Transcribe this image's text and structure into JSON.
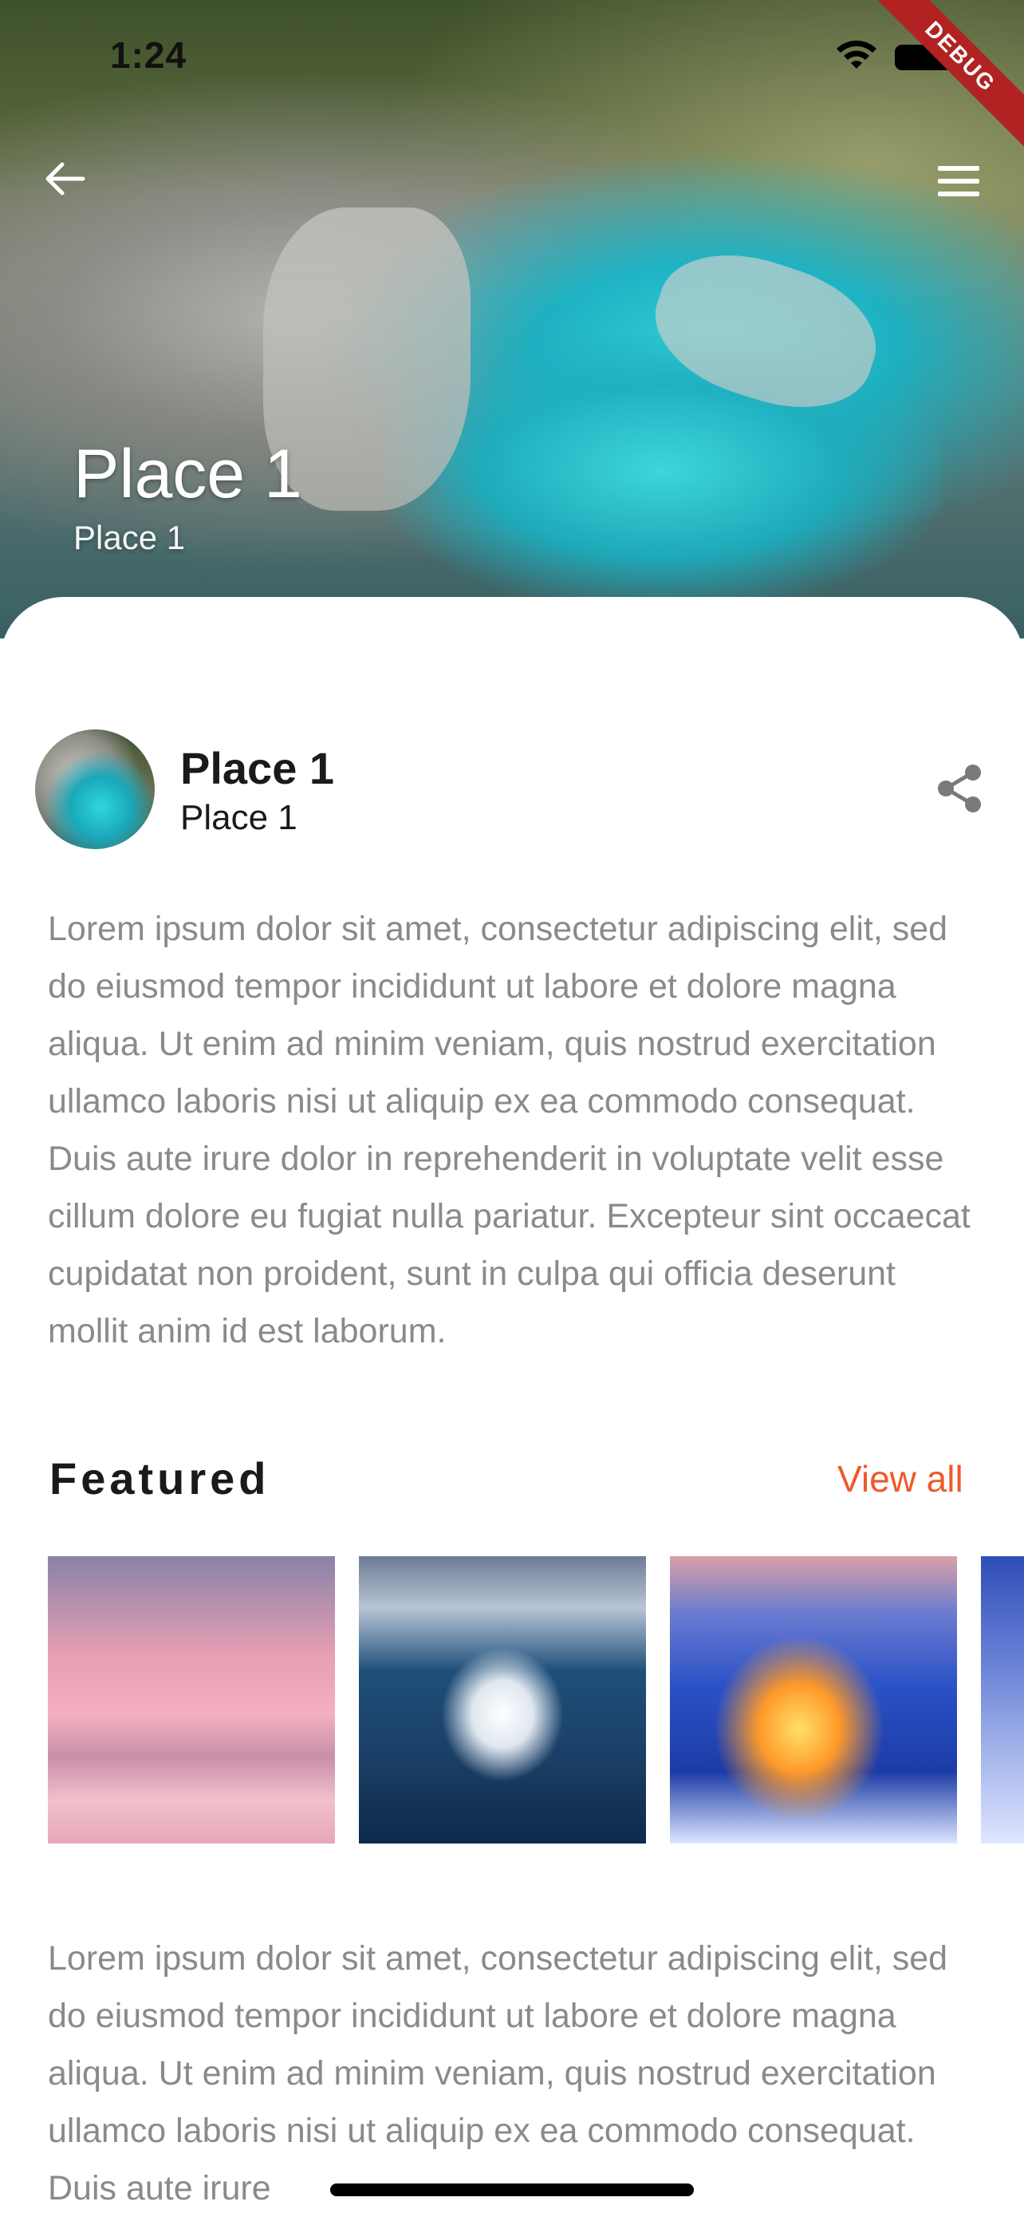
{
  "status_bar": {
    "time": "1:24"
  },
  "debug_banner": {
    "label": "DEBUG"
  },
  "header": {
    "title": "Place 1",
    "subtitle": "Place 1"
  },
  "place": {
    "name": "Place 1",
    "subtitle": "Place 1"
  },
  "description": "Lorem ipsum dolor sit amet, consectetur adipiscing elit, sed do eiusmod tempor incididunt ut labore et dolore magna aliqua. Ut enim ad minim veniam, quis nostrud exercitation ullamco laboris nisi ut aliquip ex ea commodo consequat. Duis aute irure dolor in reprehenderit in voluptate velit esse cillum dolore eu fugiat nulla pariatur. Excepteur sint occaecat cupidatat non proident, sunt in culpa qui officia deserunt mollit anim id est laborum.",
  "featured": {
    "title": "Featured",
    "view_all": "View all",
    "items": [
      {
        "icon": "sunset-beach-image"
      },
      {
        "icon": "lake-island-church-image"
      },
      {
        "icon": "snowy-village-night-image"
      },
      {
        "icon": "snowy-village-image"
      }
    ]
  },
  "description2": "Lorem ipsum dolor sit amet, consectetur adipiscing elit, sed do eiusmod tempor incididunt ut labore et dolore magna aliqua. Ut enim ad minim veniam, quis nostrud exercitation ullamco laboris nisi ut aliquip ex ea commodo consequat. Duis aute irure",
  "colors": {
    "accent": "#ee5a2a",
    "body_text": "#8a8a8a",
    "debug": "#b22222"
  }
}
